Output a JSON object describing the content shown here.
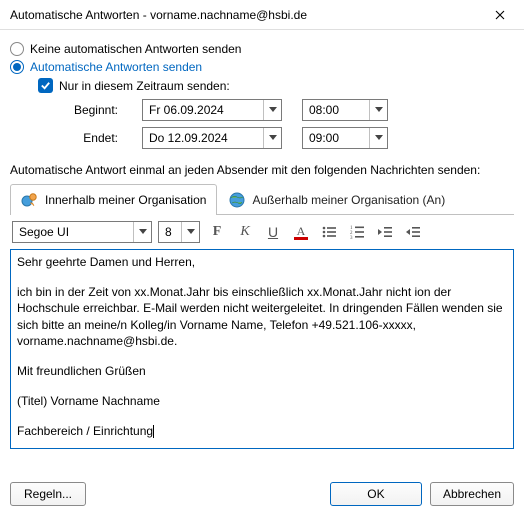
{
  "window": {
    "title": "Automatische Antworten - vorname.nachname@hsbi.de"
  },
  "options": {
    "no_auto_label": "Keine automatischen Antworten senden",
    "auto_label": "Automatische Antworten senden",
    "period_only_label": "Nur in diesem Zeitraum senden:",
    "start_label": "Beginnt:",
    "end_label": "Endet:",
    "start_date": "Fr 06.09.2024",
    "start_time": "08:00",
    "end_date": "Do 12.09.2024",
    "end_time": "09:00"
  },
  "note": "Automatische Antwort einmal an jeden Absender mit den folgenden Nachrichten senden:",
  "tabs": {
    "inside": "Innerhalb meiner Organisation",
    "outside": "Außerhalb meiner Organisation (An)"
  },
  "toolbar": {
    "font": "Segoe UI",
    "size": "8",
    "bold": "F",
    "italic": "K",
    "underline": "U",
    "color": "A"
  },
  "message": {
    "greeting": "Sehr geehrte Damen und Herren,",
    "body": "ich bin in der Zeit von xx.Monat.Jahr bis einschließlich xx.Monat.Jahr nicht ion der Hochschule erreichbar. E-Mail werden nicht weitergeleitet. In dringenden Fällen wenden sie sich bitte an meine/n Kolleg/in Vorname Name, Telefon +49.521.106-xxxxx, vorname.nachname@hsbi.de.",
    "closing": "Mit freundlichen Grüßen",
    "name": "(Titel) Vorname Nachname",
    "dept": "Fachbereich / Einrichtung"
  },
  "footer": {
    "rules": "Regeln...",
    "ok": "OK",
    "cancel": "Abbrechen"
  }
}
